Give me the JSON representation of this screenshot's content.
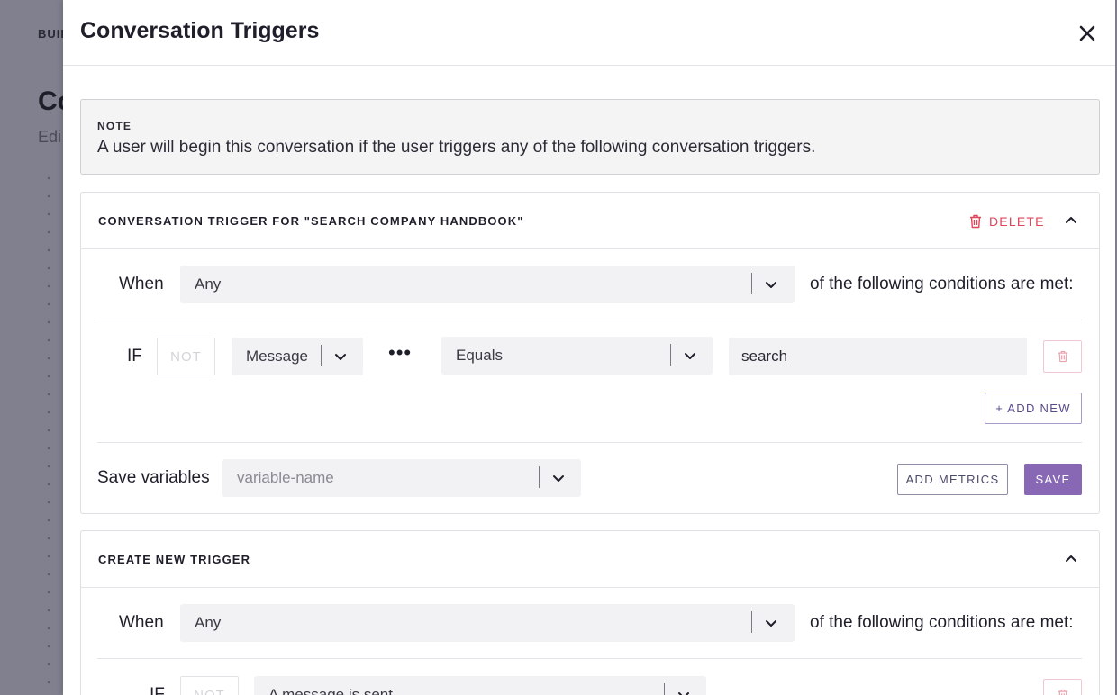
{
  "background": {
    "breadcrumb": "BUII",
    "title": "Co",
    "subtitle": "Edi"
  },
  "modal": {
    "title": "Conversation Triggers",
    "close_icon": "close-icon"
  },
  "note": {
    "label": "NOTE",
    "text": "A user will begin this conversation if the user triggers any of the following conversation triggers."
  },
  "trigger1": {
    "title": "CONVERSATION TRIGGER FOR \"SEARCH COMPANY HANDBOOK\"",
    "delete_label": "DELETE",
    "when_label": "When",
    "when_value": "Any",
    "when_suffix": "of the following conditions are met:",
    "condition": {
      "if_label": "IF",
      "not_label": "NOT",
      "field_value": "Message",
      "more_label": "•••",
      "operator_value": "Equals",
      "input_value": "search"
    },
    "add_new_label": "+ ADD NEW",
    "save_vars_label": "Save variables",
    "save_vars_placeholder": "variable-name",
    "add_metrics_label": "ADD METRICS",
    "save_label": "SAVE"
  },
  "trigger2": {
    "title": "CREATE NEW TRIGGER",
    "when_label": "When",
    "when_value": "Any",
    "when_suffix": "of the following conditions are met:",
    "condition": {
      "if_label": "IF",
      "not_label": "NOT",
      "field_value": "A message is sent"
    }
  },
  "colors": {
    "accent": "#8868b5",
    "danger": "#e0455a",
    "overlay": "#80808f"
  }
}
